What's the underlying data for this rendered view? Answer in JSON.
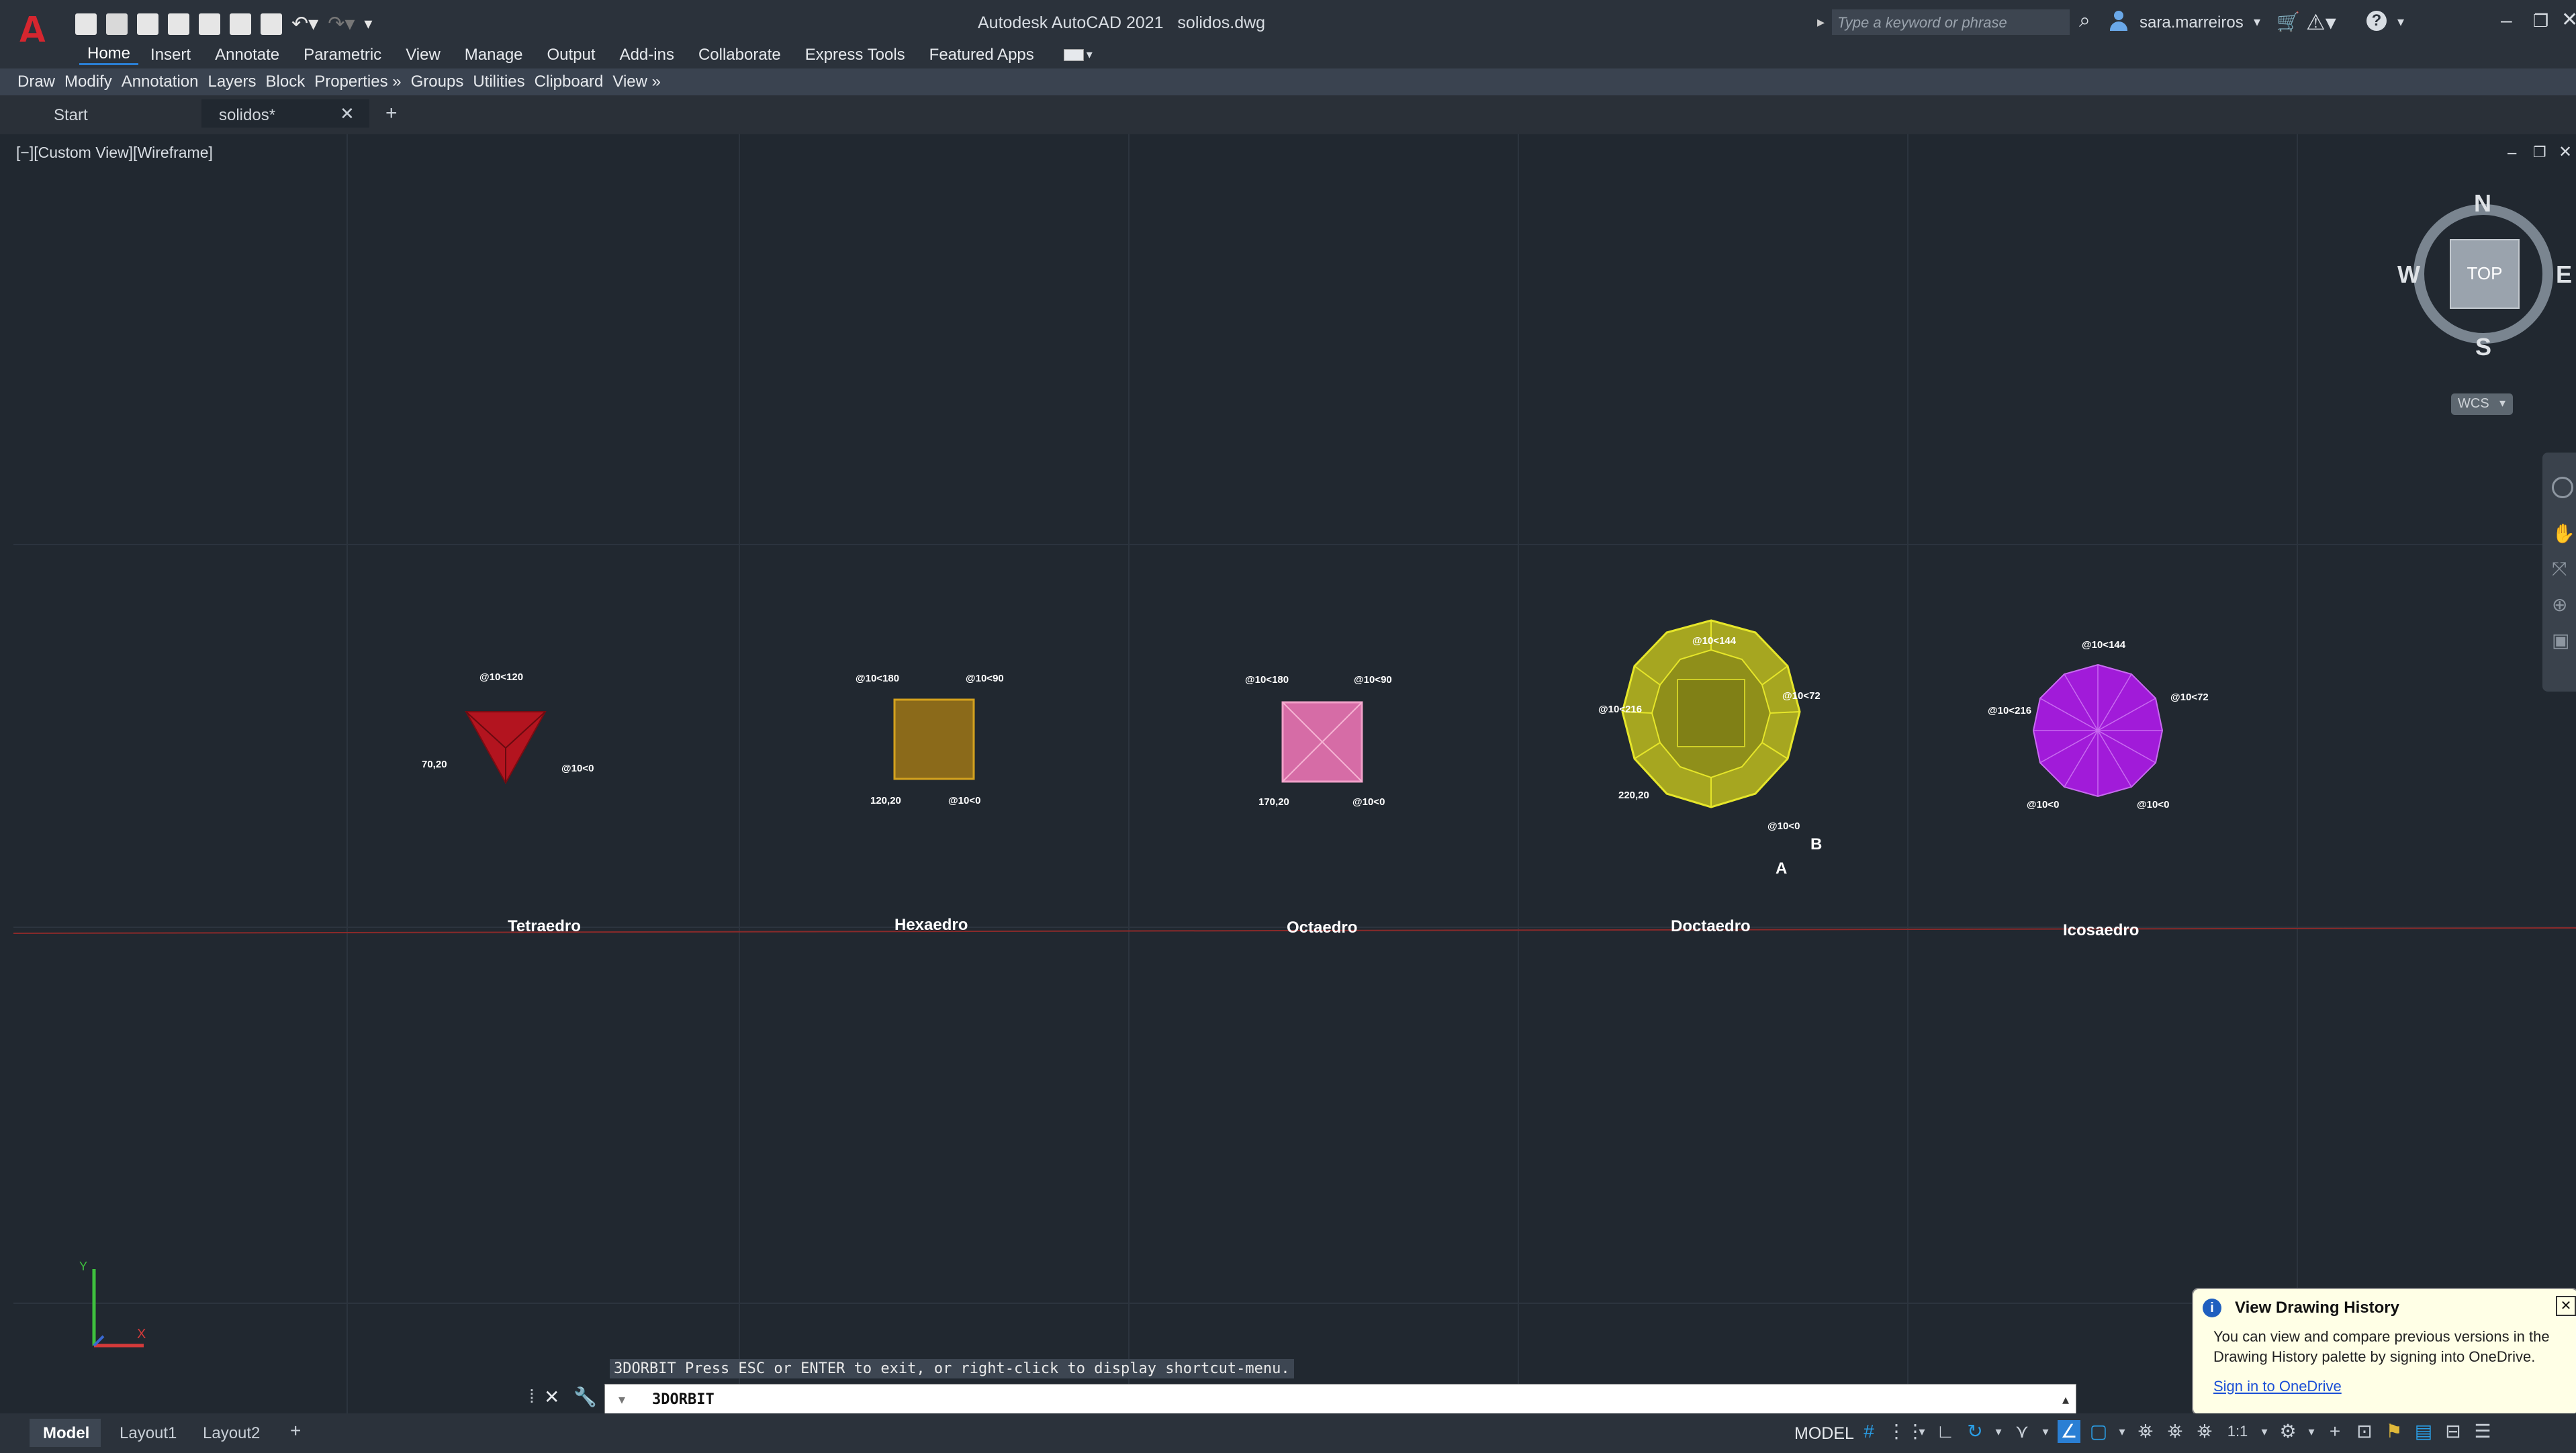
{
  "window": {
    "app_title": "Autodesk AutoCAD 2021",
    "file_name": "solidos.dwg",
    "search_placeholder": "Type a keyword or phrase",
    "user": "sara.marreiros"
  },
  "ribbon_tabs": [
    "Home",
    "Insert",
    "Annotate",
    "Parametric",
    "View",
    "Manage",
    "Output",
    "Add-ins",
    "Collaborate",
    "Express Tools",
    "Featured Apps"
  ],
  "panels": [
    "Draw",
    "Modify",
    "Annotation",
    "Layers",
    "Block",
    "Properties »",
    "Groups",
    "Utilities",
    "Clipboard",
    "View »"
  ],
  "doc_tabs": {
    "start": "Start",
    "file": "solidos*"
  },
  "viewport_label": "[−][Custom View][Wireframe]",
  "viewcube": {
    "n": "N",
    "s": "S",
    "e": "E",
    "w": "W",
    "face": "TOP",
    "wcs": "WCS"
  },
  "shapes": {
    "tetra": {
      "name": "Tetraedro",
      "c1": "@10<120",
      "c2": "70,20",
      "c3": "@10<0"
    },
    "hexa": {
      "name": "Hexaedro",
      "c1": "@10<180",
      "c2": "@10<90",
      "c3": "120,20",
      "c4": "@10<0"
    },
    "octa": {
      "name": "Octaedro",
      "c1": "@10<180",
      "c2": "@10<90",
      "c3": "170,20",
      "c4": "@10<0"
    },
    "dodeca": {
      "name": "Doctaedro",
      "c1": "@10<144",
      "c2": "@10<216",
      "c3": "@10<72",
      "c4": "220,20",
      "c5": "@10<0",
      "pa": "A",
      "pb": "B"
    },
    "icosa": {
      "name": "Icosaedro",
      "c1": "@10<144",
      "c2": "@10<216",
      "c3": "@10<72",
      "c4": "@10<0",
      "c5": "@10<0"
    }
  },
  "ucs": {
    "x": "X",
    "y": "Y"
  },
  "command": {
    "hint": "3DORBIT Press ESC or ENTER to exit, or right-click to display shortcut-menu.",
    "input": "3DORBIT"
  },
  "tooltip": {
    "title": "View Drawing History",
    "body": "You can view and compare previous versions in the Drawing History palette by signing into OneDrive.",
    "link": "Sign in to OneDrive"
  },
  "layout_tabs": [
    "Model",
    "Layout1",
    "Layout2"
  ],
  "status": {
    "mode": "MODEL",
    "scale": "1:1"
  },
  "colors": {
    "accent": "#2a7fd4",
    "tetra": "#b3141f",
    "hexa": "#9b7417",
    "octa": "#e07ab0",
    "dodeca": "#b3b327",
    "icosa": "#a11bd9"
  }
}
